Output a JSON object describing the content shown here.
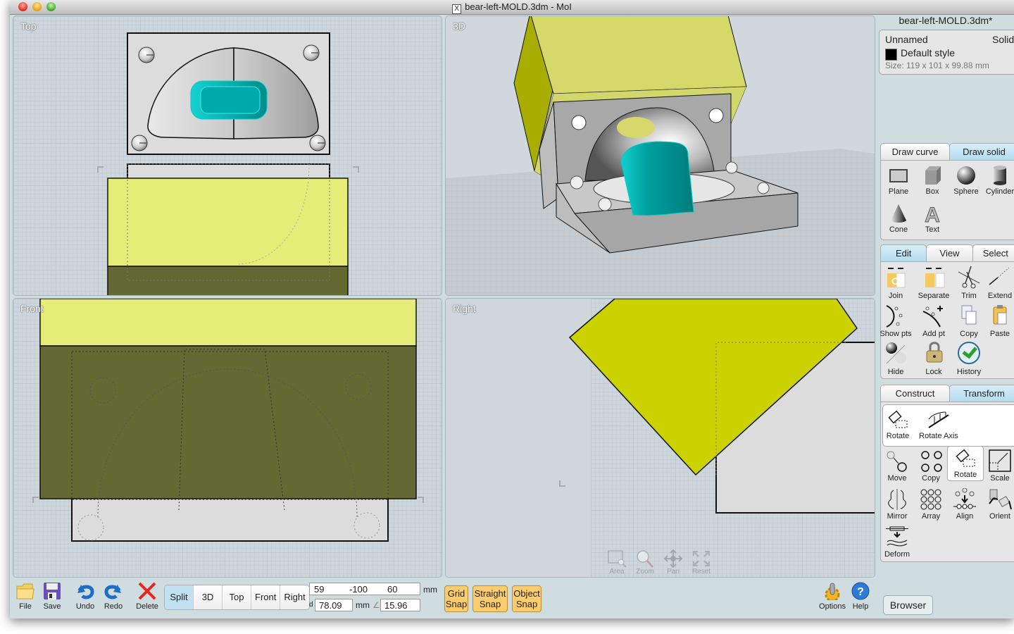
{
  "window": {
    "title": "bear-left-MOLD.3dm - MoI",
    "app_icon": "x-app-icon"
  },
  "viewports": {
    "top": {
      "label": "Top"
    },
    "perspective": {
      "label": "3D"
    },
    "front": {
      "label": "Front"
    },
    "right": {
      "label": "Right"
    },
    "nav_tools": [
      {
        "id": "area",
        "label": "Area",
        "icon": "area-zoom-icon"
      },
      {
        "id": "zoom",
        "label": "Zoom",
        "icon": "magnifier-icon"
      },
      {
        "id": "pan",
        "label": "Pan",
        "icon": "pan-arrows-icon"
      },
      {
        "id": "reset",
        "label": "Reset",
        "icon": "reset-arrows-icon"
      }
    ]
  },
  "colors": {
    "viewport_bg": "#cdd6dc",
    "mold_yellow": "#e6ec78",
    "mold_yellow_3d": "#d4d96a",
    "mold_dark_olive": "#646832",
    "right_yellow": "#ccd200",
    "part_cyan": "#00a7a7",
    "mold_grey": "#dcdcdc",
    "snap_orange": "#fccc6e",
    "tab_active_blue": "#b2dcf1"
  },
  "panel": {
    "document_title": "bear-left-MOLD.3dm*",
    "properties": {
      "name": "Unnamed",
      "type": "Solid",
      "style": "Default style",
      "size": "Size: 119 x 101 x 99.88 mm"
    },
    "draw_tabs": [
      {
        "label": "Draw curve",
        "active": false
      },
      {
        "label": "Draw solid",
        "active": true
      }
    ],
    "draw_solid_tools": [
      {
        "label": "Plane",
        "icon": "plane-icon"
      },
      {
        "label": "Box",
        "icon": "box-icon"
      },
      {
        "label": "Sphere",
        "icon": "sphere-icon"
      },
      {
        "label": "Cylinder",
        "icon": "cylinder-icon"
      },
      {
        "label": "Cone",
        "icon": "cone-icon"
      },
      {
        "label": "Text",
        "icon": "text-icon"
      }
    ],
    "edit_tabs": [
      {
        "label": "Edit",
        "active": true
      },
      {
        "label": "View",
        "active": false
      },
      {
        "label": "Select",
        "active": false
      }
    ],
    "edit_tools": [
      {
        "label": "Join",
        "icon": "join-icon"
      },
      {
        "label": "Separate",
        "icon": "separate-icon"
      },
      {
        "label": "Trim",
        "icon": "scissors-icon"
      },
      {
        "label": "Extend",
        "icon": "extend-icon"
      },
      {
        "label": "Show pts",
        "icon": "show-points-icon"
      },
      {
        "label": "Add pt",
        "icon": "add-point-icon"
      },
      {
        "label": "Copy",
        "icon": "copy-icon"
      },
      {
        "label": "Paste",
        "icon": "paste-icon"
      },
      {
        "label": "Hide",
        "icon": "hide-icon"
      },
      {
        "label": "Lock",
        "icon": "lock-icon"
      },
      {
        "label": "History",
        "icon": "history-icon"
      }
    ],
    "transform_tabs": [
      {
        "label": "Construct",
        "active": false
      },
      {
        "label": "Transform",
        "active": true
      }
    ],
    "rotate_flyout": [
      {
        "label": "Rotate",
        "icon": "rotate-icon"
      },
      {
        "label": "Rotate Axis",
        "icon": "rotate-axis-icon"
      }
    ],
    "transform_tools": [
      {
        "label": "Move",
        "icon": "move-icon"
      },
      {
        "label": "Copy",
        "icon": "copy-transform-icon"
      },
      {
        "label": "Rotate",
        "icon": "rotate-icon",
        "selected": true
      },
      {
        "label": "Scale",
        "icon": "scale-icon"
      },
      {
        "label": "Mirror",
        "icon": "mirror-icon"
      },
      {
        "label": "Array",
        "icon": "array-icon"
      },
      {
        "label": "Align",
        "icon": "align-icon"
      },
      {
        "label": "Orient",
        "icon": "orient-icon"
      },
      {
        "label": "Deform",
        "icon": "deform-icon"
      }
    ]
  },
  "bottom_bar": {
    "buttons": [
      {
        "label": "File",
        "icon": "folder-icon"
      },
      {
        "label": "Save",
        "icon": "floppy-disk-icon"
      },
      {
        "label": "Undo",
        "icon": "undo-arrow-icon"
      },
      {
        "label": "Redo",
        "icon": "redo-arrow-icon"
      },
      {
        "label": "Delete",
        "icon": "red-x-icon"
      }
    ],
    "view_switch": [
      {
        "label": "Split",
        "active": true
      },
      {
        "label": "3D",
        "active": false
      },
      {
        "label": "Top",
        "active": false
      },
      {
        "label": "Front",
        "active": false
      },
      {
        "label": "Right",
        "active": false
      }
    ],
    "coords": {
      "x": "59",
      "y": "-100",
      "z": "60",
      "unit": "mm",
      "distance_prefix": "d",
      "distance": "78.09",
      "distance_unit": "mm",
      "angle_symbol": "∠",
      "angle": "15.96"
    },
    "snaps": [
      {
        "line1": "Grid",
        "line2": "Snap"
      },
      {
        "line1": "Straight",
        "line2": "Snap"
      },
      {
        "line1": "Object",
        "line2": "Snap"
      }
    ],
    "options_label": "Options",
    "help_label": "Help",
    "browser_label": "Browser"
  }
}
